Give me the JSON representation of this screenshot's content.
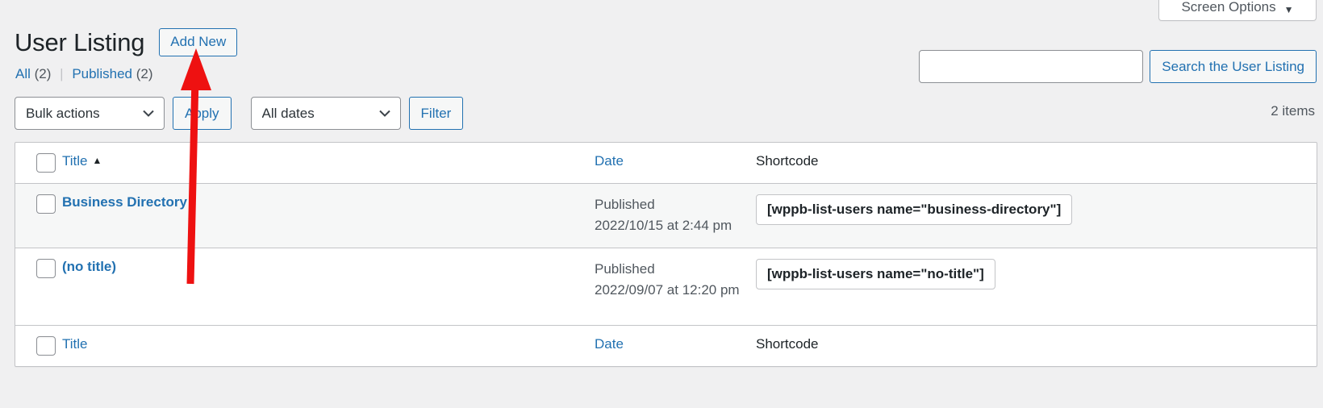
{
  "screen_options": {
    "label": "Screen Options",
    "caret": "▼"
  },
  "header": {
    "title": "User Listing",
    "add_new_label": "Add New"
  },
  "status_links": {
    "all_label": "All",
    "all_count": "(2)",
    "separator": "|",
    "published_label": "Published",
    "published_count": "(2)"
  },
  "search": {
    "value": "",
    "placeholder": "",
    "submit_label": "Search the User Listing"
  },
  "tablenav": {
    "bulk_actions_selected": "Bulk actions",
    "apply_label": "Apply",
    "dates_selected": "All dates",
    "filter_label": "Filter",
    "displaying_num": "2 items",
    "chevron": "⌄"
  },
  "table": {
    "columns": {
      "title": "Title",
      "date": "Date",
      "shortcode": "Shortcode"
    },
    "sort_indicator": "▲",
    "rows": [
      {
        "title": "Business Directory",
        "date_status": "Published",
        "date_value": "2022/10/15 at 2:44 pm",
        "shortcode": "[wppb-list-users name=\"business-directory\"]"
      },
      {
        "title": "(no title)",
        "date_status": "Published",
        "date_value": "2022/09/07 at 12:20 pm",
        "shortcode": "[wppb-list-users name=\"no-title\"]"
      }
    ]
  },
  "annotation": {
    "arrow_color": "#ee1111",
    "points_to": "add-new-button"
  }
}
